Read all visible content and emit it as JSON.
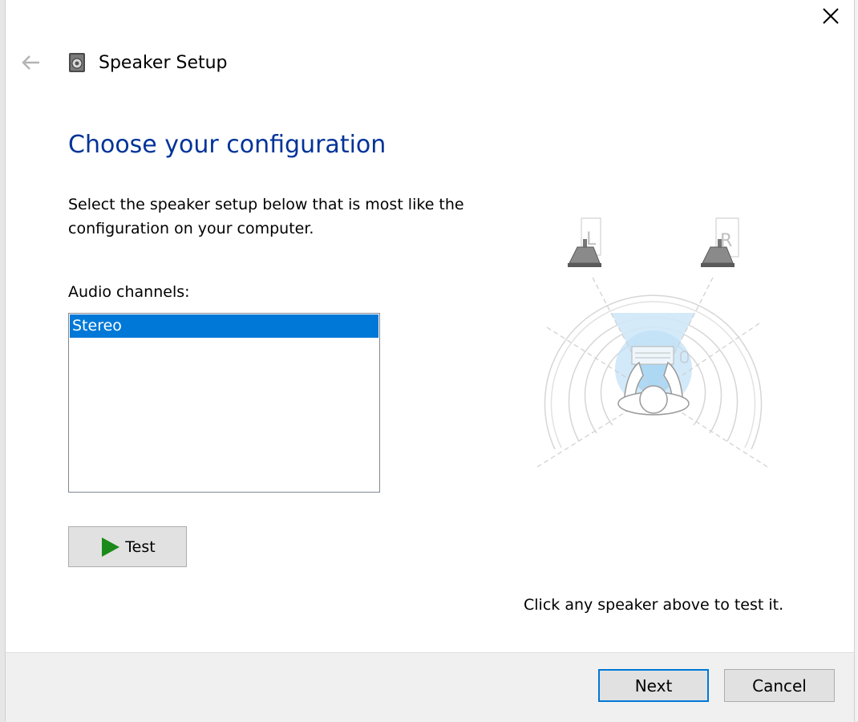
{
  "window": {
    "title": "Speaker Setup"
  },
  "page": {
    "heading": "Choose your configuration",
    "description": "Select the speaker setup below that is most like the configuration on your computer.",
    "channels_label": "Audio channels:",
    "channels": [
      {
        "label": "Stereo",
        "selected": true
      }
    ],
    "test_button": "Test",
    "hint": "Click any speaker above to test it.",
    "speakers": {
      "left_label": "L",
      "right_label": "R"
    }
  },
  "footer": {
    "next_label": "Next",
    "cancel_label": "Cancel"
  },
  "colors": {
    "accent": "#0078d7",
    "heading": "#003399",
    "play_green": "#1a8a1a",
    "cone_blue": "#a6d4f2"
  },
  "icons": {
    "close": "close-icon",
    "back": "back-arrow-icon",
    "app": "speaker-icon",
    "play": "play-icon"
  }
}
